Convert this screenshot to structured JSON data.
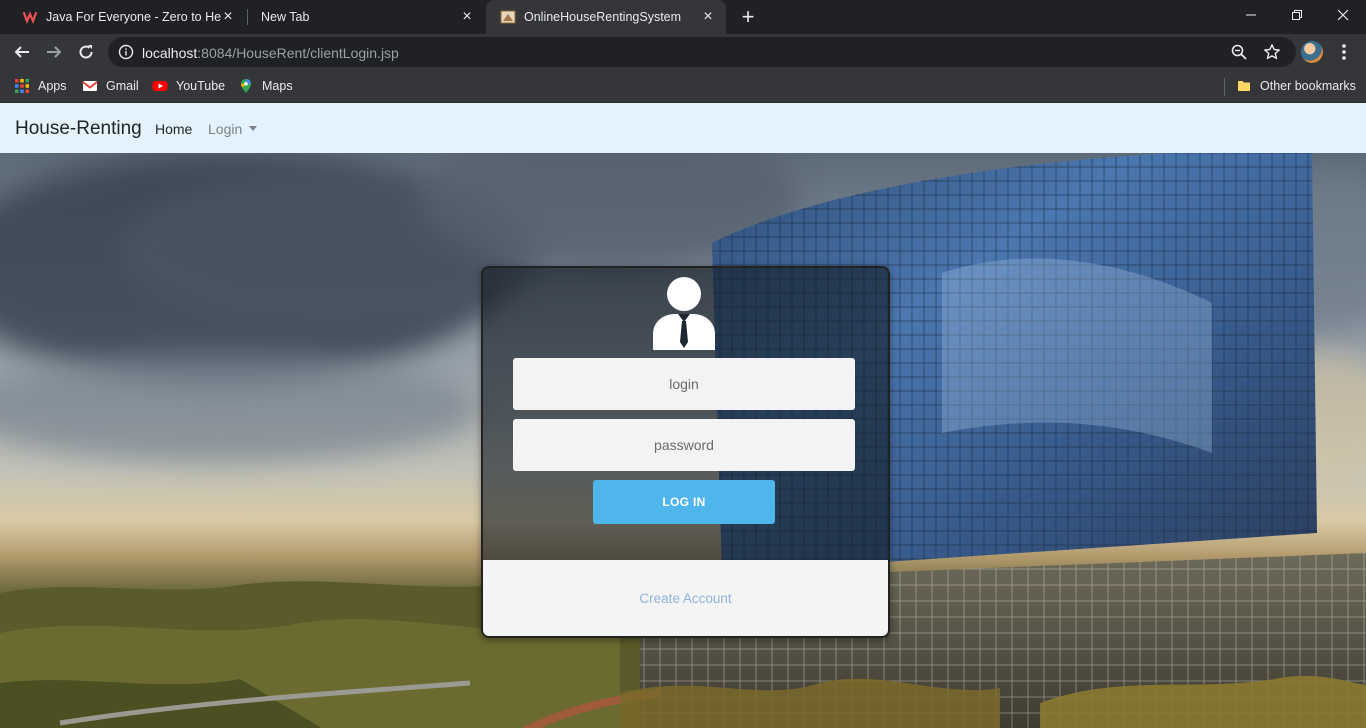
{
  "browser": {
    "tabs": [
      {
        "title": "Java For Everyone - Zero to Hero",
        "active": false
      },
      {
        "title": "New Tab",
        "active": false
      },
      {
        "title": "OnlineHouseRentingSystem",
        "active": true
      }
    ],
    "address": {
      "host": "localhost",
      "rest": ":8084/HouseRent/clientLogin.jsp"
    },
    "bookmarks": [
      {
        "label": "Apps",
        "icon": "apps-grid-icon"
      },
      {
        "label": "Gmail",
        "icon": "gmail-icon"
      },
      {
        "label": "YouTube",
        "icon": "youtube-icon"
      },
      {
        "label": "Maps",
        "icon": "maps-icon"
      }
    ],
    "other_bookmarks": "Other bookmarks"
  },
  "navbar": {
    "brand": "House-Renting",
    "home": "Home",
    "login": "Login"
  },
  "login_form": {
    "login_placeholder": "login",
    "password_placeholder": "password",
    "submit_label": "LOG IN",
    "create_account": "Create Account"
  },
  "colors": {
    "navbar_bg": "#e3f2fd",
    "button": "#4fb6ec",
    "link": "#8fb4d8"
  }
}
